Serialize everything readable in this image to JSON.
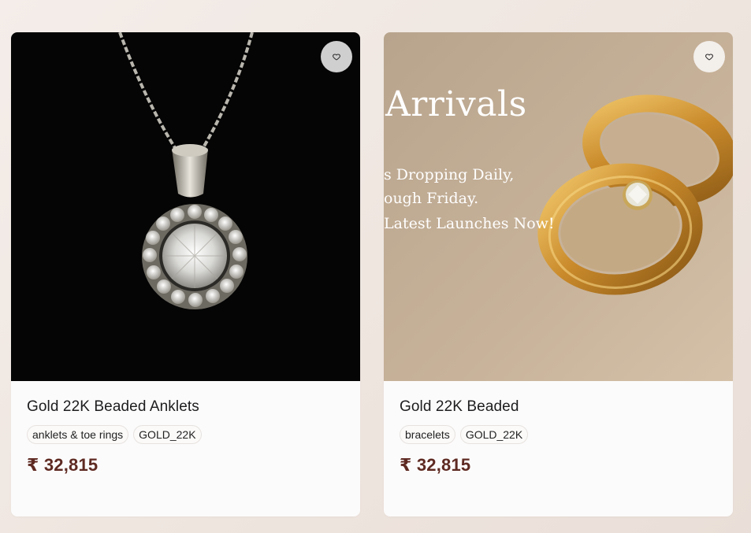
{
  "products": [
    {
      "title": "Gold 22K Beaded Anklets",
      "tags": [
        "anklets & toe rings",
        "GOLD_22K"
      ],
      "price": "₹ 32,815",
      "favorite_icon": "heart-icon",
      "image": "pendant-necklace-image"
    },
    {
      "title": "Gold 22K Beaded",
      "tags": [
        "bracelets",
        "GOLD_22K"
      ],
      "price": "₹ 32,815",
      "favorite_icon": "heart-icon",
      "image": "gold-rings-banner-image",
      "banner": {
        "title": "Arrivals",
        "line1": "s Dropping Daily,",
        "line2": "ough Friday.",
        "line3": "Latest Launches Now!"
      }
    }
  ],
  "colors": {
    "price": "#5e2a22",
    "background": "#efe6e0",
    "card": "#fcfbfb"
  }
}
